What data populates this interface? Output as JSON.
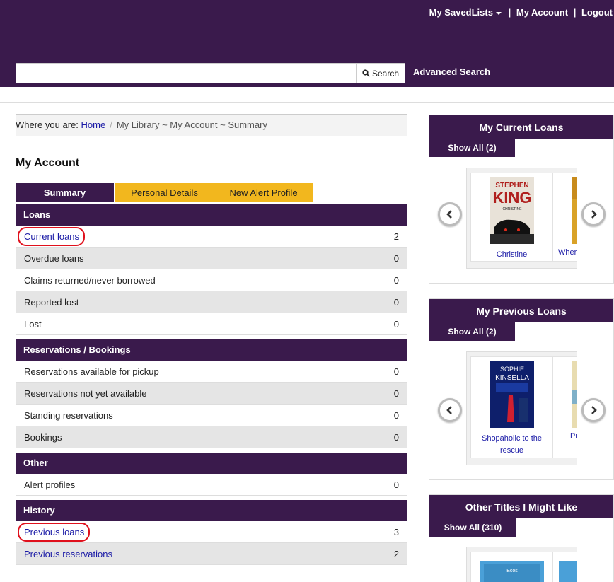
{
  "header": {
    "saved_lists": "My SavedLists",
    "sep": "|",
    "my_account": "My Account",
    "logout": "Logout"
  },
  "search": {
    "value": "",
    "placeholder": "",
    "button_label": "Search",
    "advanced": "Advanced Search"
  },
  "breadcrumb": {
    "prefix": "Where you are:",
    "home": "Home",
    "separator": "/",
    "current": "My Library ~ My Account ~ Summary"
  },
  "page_title": "My Account",
  "tabs": [
    {
      "label": "Summary",
      "active": true
    },
    {
      "label": "Personal Details",
      "active": false
    },
    {
      "label": "New Alert Profile",
      "active": false
    }
  ],
  "sections": {
    "loans": {
      "title": "Loans",
      "rows": [
        {
          "label": "Current loans",
          "count": "2"
        },
        {
          "label": "Overdue loans",
          "count": "0"
        },
        {
          "label": "Claims returned/never borrowed",
          "count": "0"
        },
        {
          "label": "Reported lost",
          "count": "0"
        },
        {
          "label": "Lost",
          "count": "0"
        }
      ]
    },
    "reservations": {
      "title": "Reservations / Bookings",
      "rows": [
        {
          "label": "Reservations available for pickup",
          "count": "0"
        },
        {
          "label": "Reservations not yet available",
          "count": "0"
        },
        {
          "label": "Standing reservations",
          "count": "0"
        },
        {
          "label": "Bookings",
          "count": "0"
        }
      ]
    },
    "other": {
      "title": "Other",
      "rows": [
        {
          "label": "Alert profiles",
          "count": "0"
        }
      ]
    },
    "history": {
      "title": "History",
      "rows": [
        {
          "label": "Previous loans",
          "count": "3"
        },
        {
          "label": "Previous reservations",
          "count": "2"
        }
      ]
    }
  },
  "panels": {
    "current_loans": {
      "title": "My Current Loans",
      "show_all": "Show All (2)",
      "book1": {
        "title": "Christine",
        "cover_lines": [
          "STEPHEN",
          "KING",
          "CHRISTINE"
        ]
      },
      "book2": {
        "title": "Wher"
      }
    },
    "previous_loans": {
      "title": "My Previous Loans",
      "show_all": "Show All (2)",
      "book1": {
        "title_line1": "Shopaholic to the",
        "title_line2": "rescue",
        "cover_lines": [
          "SOPHIE",
          "KINSELLA"
        ]
      },
      "book2": {
        "title": "Pr"
      }
    },
    "other_titles": {
      "title": "Other Titles I Might Like",
      "show_all": "Show All (310)",
      "book1": {
        "cover_lines": [
          "Ecos"
        ]
      }
    }
  },
  "colors": {
    "brand_purple": "#3a1a4c",
    "tab_yellow": "#f2b71e",
    "link_blue": "#1a1aa6",
    "highlight_red": "#e0101c"
  }
}
